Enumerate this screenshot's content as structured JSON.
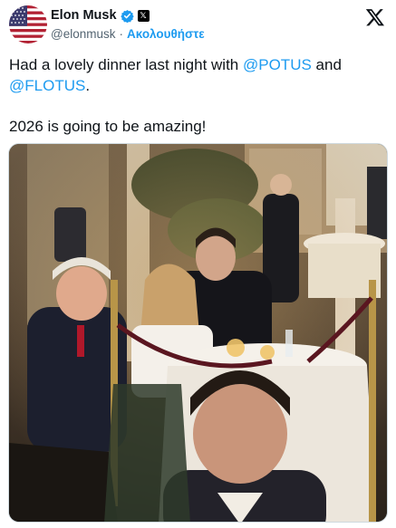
{
  "author": {
    "display_name": "Elon Musk",
    "handle": "@elonmusk",
    "separator": "·",
    "follow_label": "Ακολουθήστε",
    "avatar_icon": "us-flag-icon",
    "verified_icon": "verified-badge-icon",
    "affiliation_icon": "x-affiliation-icon"
  },
  "platform_icon": "x-logo-icon",
  "tweet": {
    "line1_prefix": "Had a lovely dinner last night with ",
    "mention1": "@POTUS",
    "line1_suffix": " and",
    "mention2": "@FLOTUS",
    "line2_suffix": ".",
    "line3": "2026 is going to be amazing!"
  },
  "media": {
    "type": "photo",
    "icon": "dinner-photo"
  },
  "colors": {
    "accent": "#1d9bf0",
    "text": "#0f1419",
    "muted": "#536471"
  }
}
